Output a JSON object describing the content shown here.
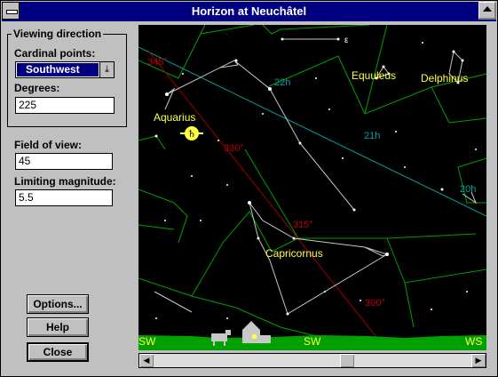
{
  "window": {
    "title": "Horizon at Neuchâtel"
  },
  "viewing_direction": {
    "group_label": "Viewing direction",
    "cardinal_label": "Cardinal points:",
    "cardinal_value": "Southwest",
    "degrees_label": "Degrees:",
    "degrees_value": "225"
  },
  "field_of_view": {
    "label": "Field of view:",
    "value": "45"
  },
  "limiting_magnitude": {
    "label": "Limiting magnitude:",
    "value": "5.5"
  },
  "buttons": {
    "options": "Options...",
    "help": "Help",
    "close": "Close"
  },
  "sky": {
    "constellations": [
      "Aquarius",
      "Equuleus",
      "Delphinus",
      "Capricornus"
    ],
    "ra_labels": [
      "22h",
      "21h",
      "20h"
    ],
    "ecliptic_labels": [
      "345°",
      "330°",
      "315°",
      "300°"
    ],
    "star_label": "ε",
    "horizon_labels": [
      "SW",
      "SW",
      "WS"
    ],
    "planet_symbol": "♄",
    "colors": {
      "sky": "#000000",
      "boundary": "#00a000",
      "ecliptic": "#a00000",
      "equator": "#00a0a0",
      "label": "#ffff40",
      "ground": "#00a000"
    }
  }
}
